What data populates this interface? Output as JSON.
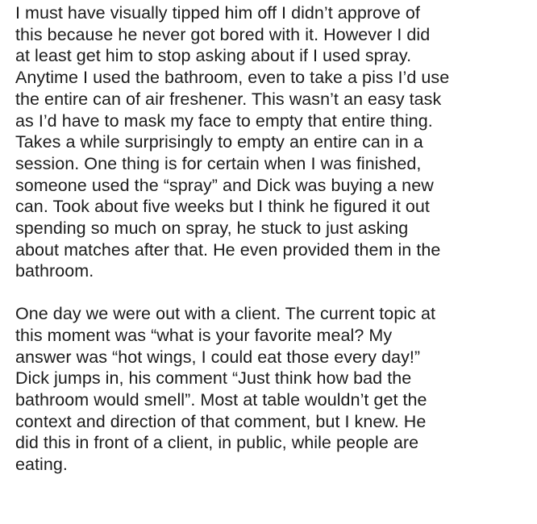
{
  "paragraphs": [
    {
      "lines": [
        "I must have visually tipped him off I didn’t approve of",
        "this because he never got bored with it. However I did",
        "at least get him to stop asking about if I used spray.",
        "Anytime I used the bathroom, even to take a piss I’d use",
        "the entire can of air freshener. This wasn’t an easy task",
        "as I’d have to mask my face to empty that entire thing.",
        "Takes a while surprisingly to empty an entire can in a",
        "session. One thing is for certain when I was finished,",
        "someone used the “spray” and Dick was buying a new",
        "can. Took about five weeks but I think he figured it out",
        "spending so much on spray, he stuck to just asking",
        "about matches after that. He even provided them in the",
        "bathroom."
      ]
    },
    {
      "lines": [
        "One day we were out with a client.  The current topic at",
        "this moment was “what is your favorite meal? My",
        "answer was “hot wings, I could eat those every day!”",
        "Dick jumps in, his comment “Just think how bad the",
        "bathroom would smell”. Most at table wouldn’t get the",
        "context and direction of that comment, but I knew.  He",
        "did this in front of a client, in public, while people are",
        "eating."
      ]
    }
  ]
}
